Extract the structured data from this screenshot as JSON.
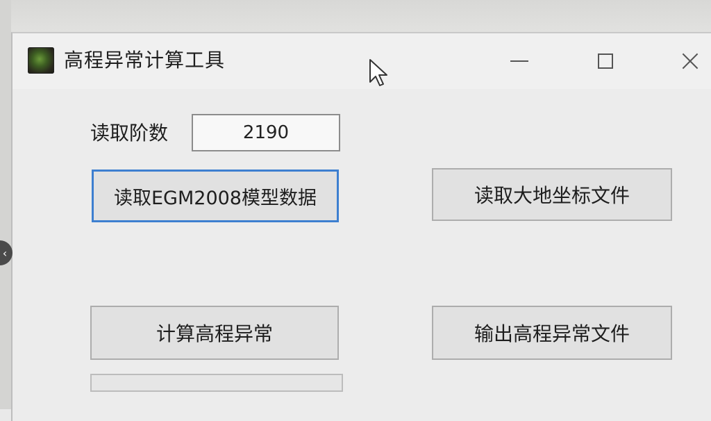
{
  "window": {
    "title": "高程异常计算工具",
    "controls": {
      "minimize": "—",
      "maximize": "☐",
      "close": "✕"
    }
  },
  "form": {
    "order_label": "读取阶数",
    "order_value": "2190",
    "progress": 0
  },
  "buttons": {
    "read_egm": "读取EGM2008模型数据",
    "read_geodetic": "读取大地坐标文件",
    "compute": "计算高程异常",
    "export": "输出高程异常文件"
  },
  "overlay": {
    "side_arrow": "‹"
  },
  "colors": {
    "focus_border": "#3d7fd0",
    "button_face": "#e1e1e1",
    "window_bg": "#ececec",
    "progress_fill": "#06b025"
  }
}
